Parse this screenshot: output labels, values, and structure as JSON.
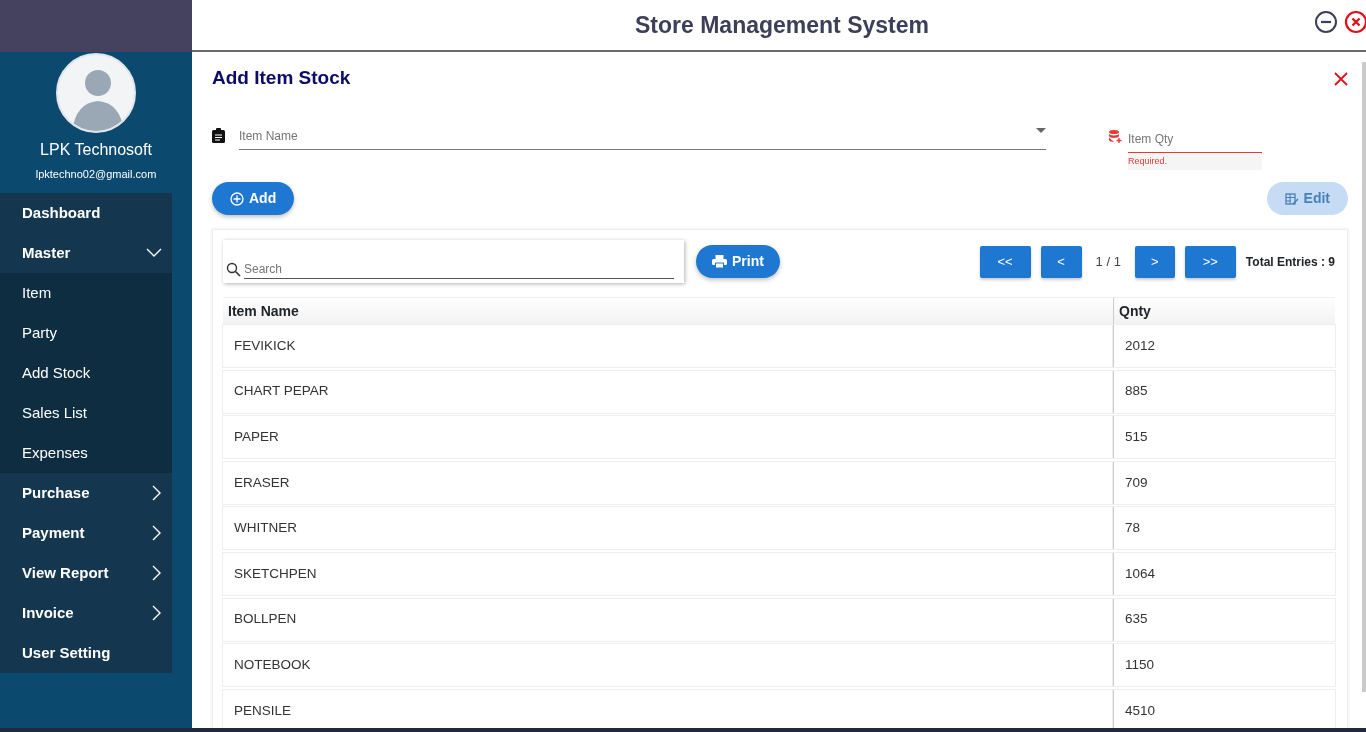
{
  "window": {
    "title": "Store Management System"
  },
  "user": {
    "name": "LPK Technosoft",
    "email": "lpktechno02@gmail.com"
  },
  "menu": [
    {
      "label": "Dashboard",
      "kind": "top"
    },
    {
      "label": "Master",
      "kind": "top",
      "expanded": true
    },
    {
      "label": "Item",
      "kind": "sub"
    },
    {
      "label": "Party",
      "kind": "sub"
    },
    {
      "label": "Add Stock",
      "kind": "sub"
    },
    {
      "label": "Sales List",
      "kind": "sub"
    },
    {
      "label": "Expenses",
      "kind": "sub"
    },
    {
      "label": "Purchase",
      "kind": "top",
      "expanded": false
    },
    {
      "label": "Payment",
      "kind": "top",
      "expanded": false
    },
    {
      "label": "View Report",
      "kind": "top",
      "expanded": false
    },
    {
      "label": "Invoice",
      "kind": "top",
      "expanded": false
    },
    {
      "label": "User Setting",
      "kind": "top"
    }
  ],
  "form": {
    "title": "Add Item Stock",
    "item_name": {
      "placeholder": "Item Name"
    },
    "item_qty": {
      "placeholder": "Item Qty",
      "error": "Required."
    },
    "add_button": {
      "label": "Add",
      "disabled": false
    },
    "edit_button": {
      "label": "Edit",
      "disabled": true
    }
  },
  "toolbar": {
    "search": {
      "placeholder": "Search"
    },
    "print_button": "Print",
    "pager": {
      "first": "<<",
      "prev": "<",
      "page": "1 / 1",
      "next": ">",
      "last": ">>"
    },
    "total": "Total Entries : 9"
  },
  "table": {
    "columns": [
      "Item Name",
      "Qnty"
    ],
    "rows": [
      [
        "FEVIKICK",
        "2012"
      ],
      [
        "CHART PEPAR",
        "885"
      ],
      [
        "PAPER",
        "515"
      ],
      [
        "ERASER",
        "709"
      ],
      [
        "WHITNER",
        "78"
      ],
      [
        "SKETCHPEN",
        "1064"
      ],
      [
        "BOLLPEN",
        "635"
      ],
      [
        "NOTEBOOK",
        "1150"
      ],
      [
        "PENSILE",
        "4510"
      ]
    ]
  }
}
